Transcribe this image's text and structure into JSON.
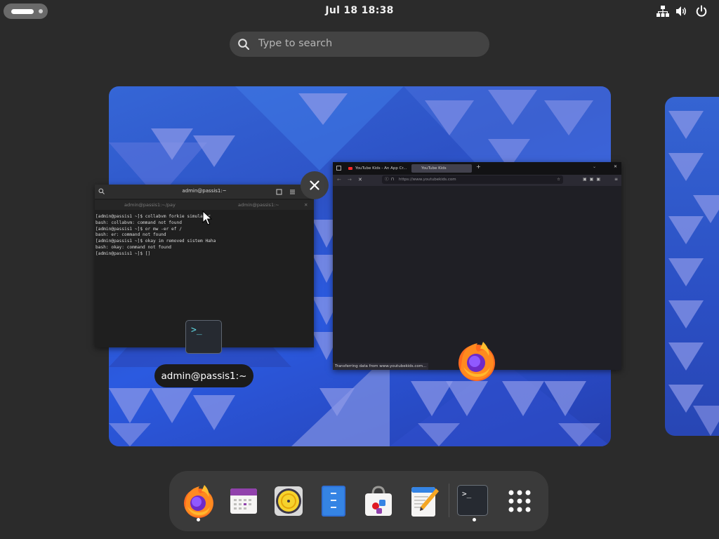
{
  "topbar": {
    "clock": "Jul 18  18:38",
    "icons": [
      "network-icon",
      "volume-icon",
      "power-icon"
    ]
  },
  "search": {
    "placeholder": "Type to search",
    "icon": "search-icon"
  },
  "terminal_window": {
    "title": "admin@passis1:~",
    "tabs": [
      "admin@passis1:~/pay",
      "admin@passis1:~"
    ],
    "lines": [
      "[admin@passis1 ~]$ collabvm forkie simulator",
      "bash: collabvm: command not found",
      "[admin@passis1 ~]$ or mw -er ef /",
      "bash: er: command not found",
      "[admin@passis1 ~]$ okay im removed sistem Haha",
      "bash: okay: command not found",
      "[admin@passis1 ~]$ []"
    ],
    "badge_glyph": ">_",
    "label": "admin@passis1:~"
  },
  "browser_window": {
    "tabs": [
      "YouTube Kids - An App Cr...",
      "YouTube Kids"
    ],
    "url": "https://www.youtubekids.com",
    "status": "Transferring data from www.youtubekids.com..."
  },
  "dock": {
    "items": [
      {
        "name": "firefox",
        "running": true
      },
      {
        "name": "calendar",
        "running": false
      },
      {
        "name": "rhythmbox",
        "running": false
      },
      {
        "name": "text-document",
        "running": false
      },
      {
        "name": "software-store",
        "running": false
      },
      {
        "name": "text-editor",
        "running": false
      },
      {
        "name": "terminal",
        "running": true
      },
      {
        "name": "show-apps",
        "running": false
      }
    ],
    "terminal_glyph": ">_"
  },
  "colors": {
    "background": "#2b2b2b",
    "wallpaper": "#2d52c6",
    "dock": "#3a3a3a"
  }
}
